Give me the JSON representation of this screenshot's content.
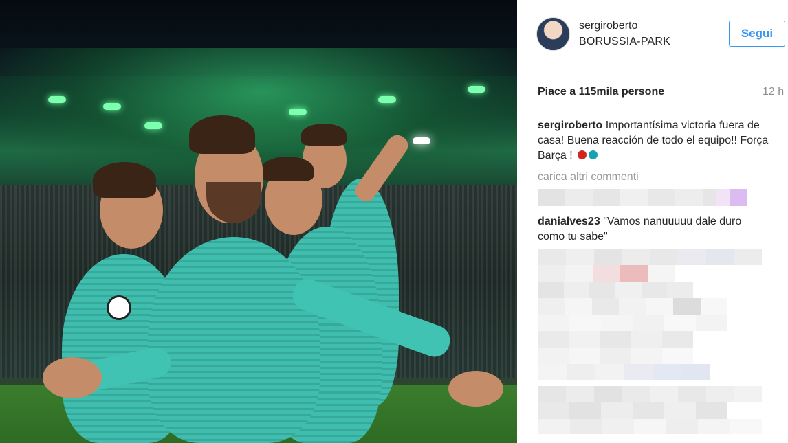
{
  "post": {
    "username": "sergiroberto",
    "location": "BORUSSIA-PARK",
    "follow_label": "Segui",
    "likes_text": "Piace a 115mila persone",
    "time_text": "12 h",
    "caption_user": "sergiroberto",
    "caption_text": "Importantísima victoria fuera de casa! Buena reacción de todo el equipo!! Força Barça !",
    "caption_emoji_colors": [
      "#d0261d",
      "#16a2b3"
    ],
    "load_more_label": "carica altri commenti"
  },
  "comments": [
    {
      "user": "danialves23",
      "text": "\"Vamos nanuuuuu dale duro como tu sabe\""
    }
  ],
  "photo": {
    "description_icon": "photo-image"
  },
  "colors": {
    "accent": "#3897f0",
    "text": "#262626",
    "muted": "#8e8e8e",
    "jersey": "#41c3b3"
  }
}
